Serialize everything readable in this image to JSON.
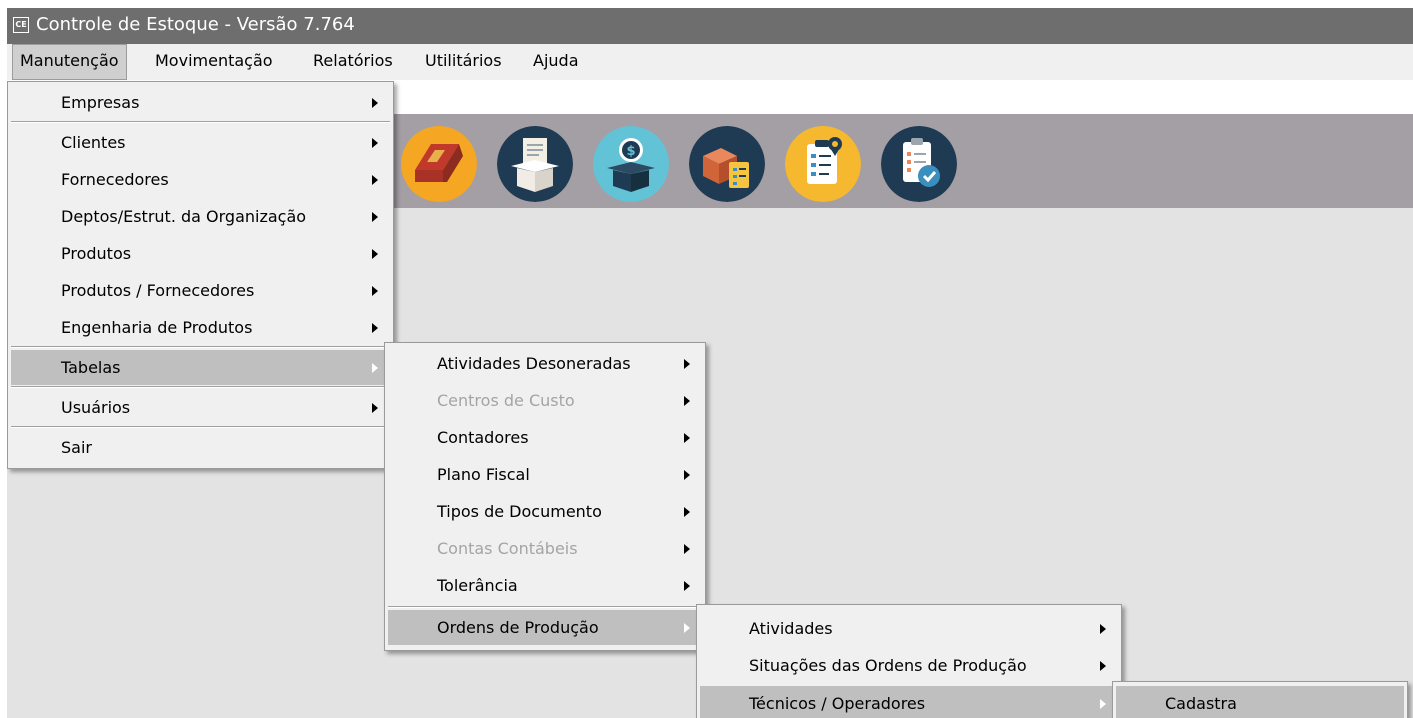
{
  "app": {
    "icon_text": "CE",
    "title": "Controle de Estoque - Versão 7.764"
  },
  "menubar": {
    "items": [
      "Manutenção",
      "Movimentação",
      "Relatórios",
      "Utilitários",
      "Ajuda"
    ],
    "active": "Manutenção"
  },
  "toolbar": {
    "icons": [
      "shipping-box-icon",
      "document-box-icon",
      "money-box-icon",
      "inventory-checklist-icon",
      "clipboard-location-icon",
      "clipboard-check-icon"
    ],
    "colors": [
      "#f5a623",
      "#1f3b53",
      "#62c2d6",
      "#1f3b53",
      "#f5b82e",
      "#1f3b53"
    ]
  },
  "menus": {
    "manutencao": {
      "items": [
        {
          "label": "Empresas",
          "submenu": true
        },
        {
          "label": "Clientes",
          "submenu": true
        },
        {
          "label": "Fornecedores",
          "submenu": true
        },
        {
          "label": "Deptos/Estrut. da Organização",
          "submenu": true
        },
        {
          "label": "Produtos",
          "submenu": true
        },
        {
          "label": "Produtos / Fornecedores",
          "submenu": true
        },
        {
          "label": "Engenharia de Produtos",
          "submenu": true
        },
        {
          "label": "Tabelas",
          "submenu": true,
          "highlighted": true
        },
        {
          "label": "Usuários",
          "submenu": true
        },
        {
          "label": "Sair",
          "submenu": false
        }
      ]
    },
    "tabelas": {
      "items": [
        {
          "label": "Atividades Desoneradas",
          "submenu": true
        },
        {
          "label": "Centros de Custo",
          "submenu": true,
          "disabled": true
        },
        {
          "label": "Contadores",
          "submenu": true
        },
        {
          "label": "Plano Fiscal",
          "submenu": true
        },
        {
          "label": "Tipos de Documento",
          "submenu": true
        },
        {
          "label": "Contas Contábeis",
          "submenu": true,
          "disabled": true
        },
        {
          "label": "Tolerância",
          "submenu": true
        },
        {
          "label": "Ordens de Produção",
          "submenu": true,
          "highlighted": true
        }
      ]
    },
    "ordens_producao": {
      "items": [
        {
          "label": "Atividades",
          "submenu": true
        },
        {
          "label": "Situações das Ordens de Produção",
          "submenu": true
        },
        {
          "label": "Técnicos / Operadores",
          "submenu": true,
          "highlighted": true
        }
      ]
    },
    "tecnicos": {
      "items": [
        {
          "label": "Cadastra",
          "submenu": false
        }
      ]
    }
  }
}
